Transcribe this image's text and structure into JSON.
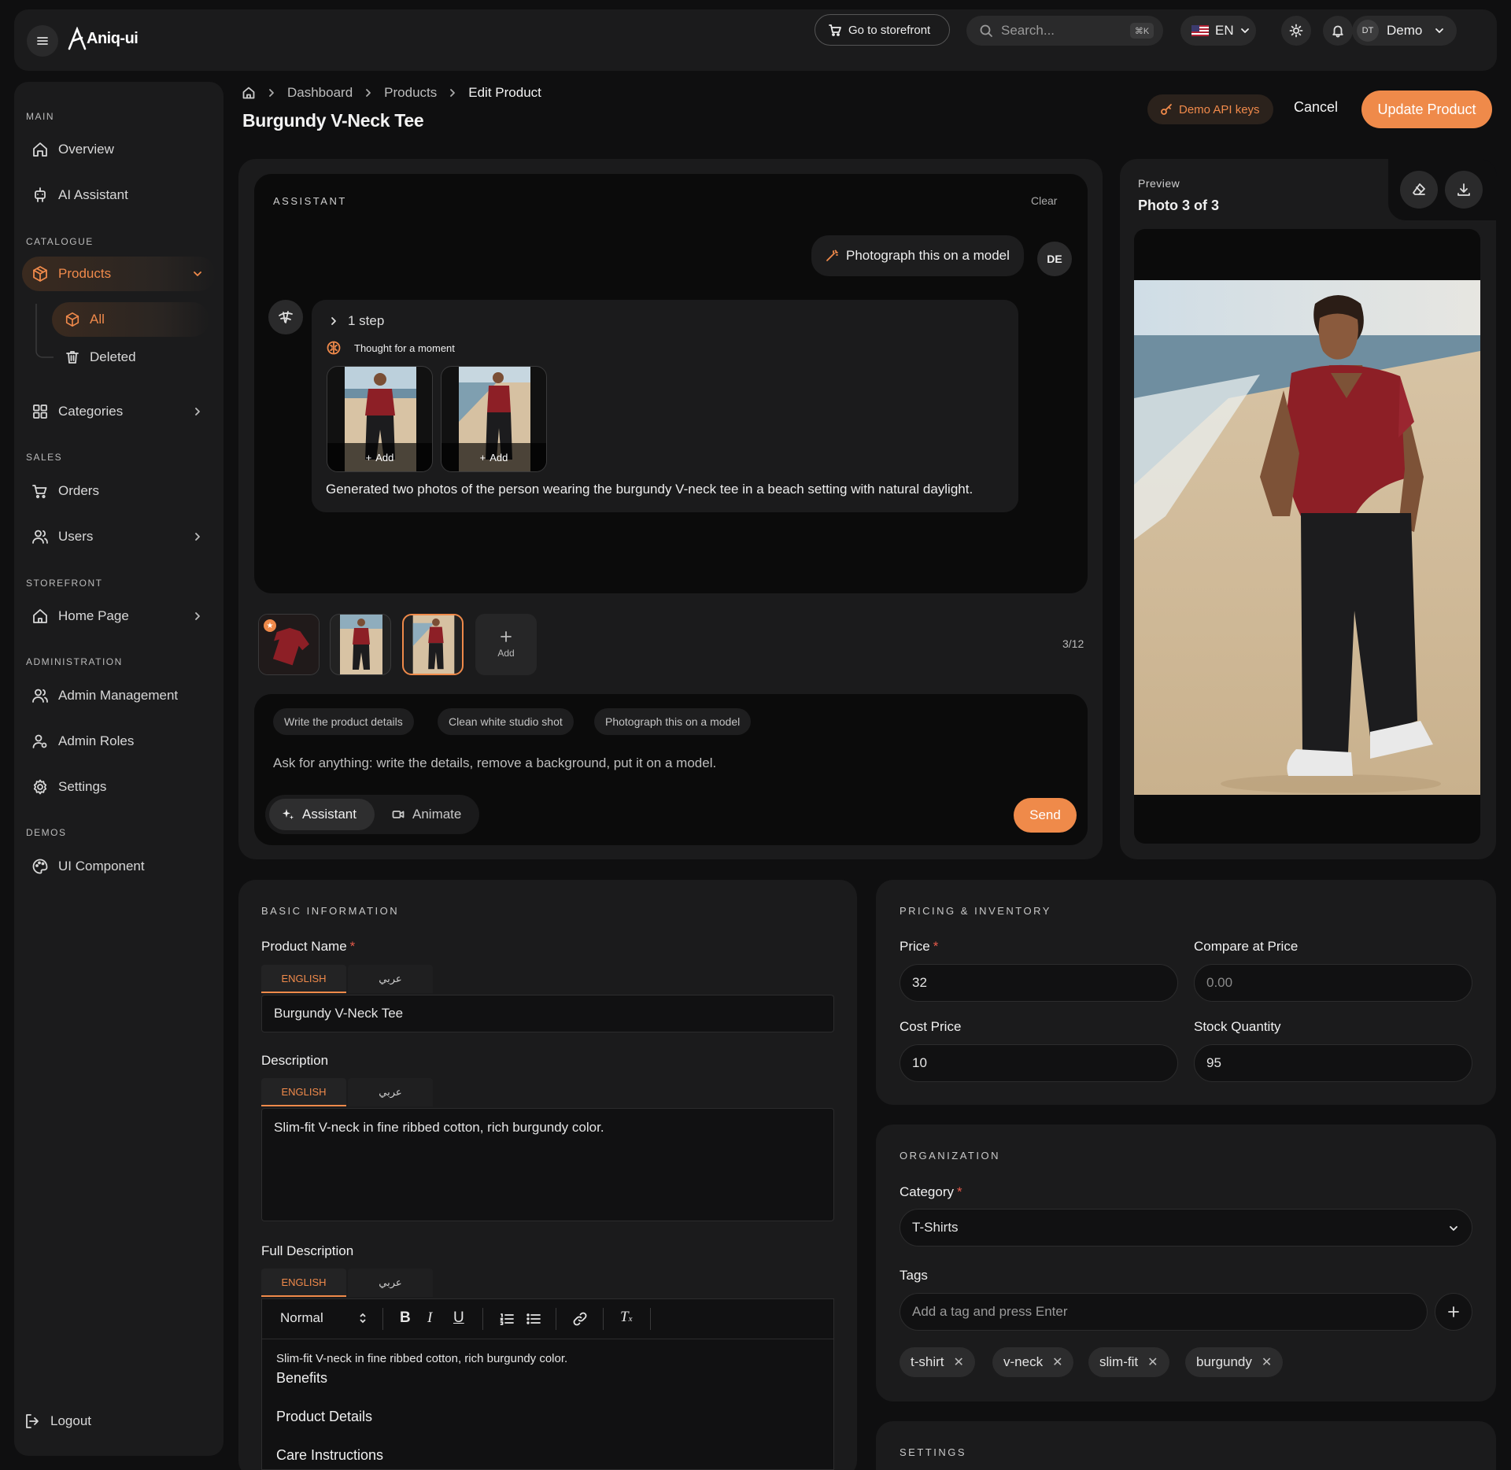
{
  "topbar": {
    "brand": "Aniq-ui",
    "storefront": "Go to storefront",
    "search_placeholder": "Search...",
    "search_kbd": "⌘K",
    "lang": "EN",
    "user_initials": "DT",
    "user_name": "Demo"
  },
  "sidebar": {
    "sections": {
      "main": "MAIN",
      "catalogue": "CATALOGUE",
      "sales": "SALES",
      "storefront": "STOREFRONT",
      "administration": "ADMINISTRATION",
      "demos": "DEMOS"
    },
    "items": {
      "overview": "Overview",
      "ai_assistant": "AI Assistant",
      "products": "Products",
      "all": "All",
      "deleted": "Deleted",
      "categories": "Categories",
      "orders": "Orders",
      "users": "Users",
      "home_page": "Home Page",
      "admin_management": "Admin Management",
      "admin_roles": "Admin Roles",
      "settings": "Settings",
      "ui_component": "UI Component",
      "logout": "Logout"
    }
  },
  "breadcrumb": [
    "Dashboard",
    "Products",
    "Edit Product"
  ],
  "page_title": "Burgundy V-Neck Tee",
  "actions": {
    "api_keys": "Demo API keys",
    "cancel": "Cancel",
    "update": "Update Product"
  },
  "assistant": {
    "title": "ASSISTANT",
    "clear": "Clear",
    "user_message": "Photograph this on a model",
    "user_initials": "DE",
    "steps": "1 step",
    "thought": "Thought for a moment",
    "add_label": "Add",
    "response": "Generated two photos of the person wearing the burgundy V-neck tee in a beach setting with natural daylight.",
    "gallery_add": "Add",
    "gallery_count": "3/12",
    "suggestions": [
      "Write the product details",
      "Clean white studio shot",
      "Photograph this on a model"
    ],
    "input_placeholder": "Ask for anything: write the details, remove a background, put it on a model.",
    "mode_assistant": "Assistant",
    "mode_animate": "Animate",
    "send": "Send"
  },
  "preview": {
    "label": "Preview",
    "photo": "Photo 3 of 3"
  },
  "basic": {
    "title": "BASIC INFORMATION",
    "name_label": "Product Name",
    "lang_en": "ENGLISH",
    "lang_ar": "عربي",
    "name_value": "Burgundy V-Neck Tee",
    "desc_label": "Description",
    "desc_value": "Slim-fit V-neck in fine ribbed cotton, rich burgundy color.",
    "full_label": "Full Description",
    "editor_style": "Normal",
    "full_line1": "Slim-fit V-neck in fine ribbed cotton, rich burgundy color.",
    "full_h1": "Benefits",
    "full_h2": "Product Details",
    "full_h3": "Care Instructions"
  },
  "pricing": {
    "title": "PRICING & INVENTORY",
    "price_label": "Price",
    "price": "32",
    "compare_label": "Compare at Price",
    "compare_placeholder": "0.00",
    "cost_label": "Cost Price",
    "cost": "10",
    "stock_label": "Stock Quantity",
    "stock": "95"
  },
  "organization": {
    "title": "ORGANIZATION",
    "category_label": "Category",
    "category": "T-Shirts",
    "tags_label": "Tags",
    "tags_placeholder": "Add a tag and press Enter",
    "tags": [
      "t-shirt",
      "v-neck",
      "slim-fit",
      "burgundy"
    ]
  },
  "settings_card": {
    "title": "SETTINGS"
  },
  "colors": {
    "accent": "#ef8a4a",
    "bg": "#0f0f10",
    "card": "#1b1b1c"
  }
}
